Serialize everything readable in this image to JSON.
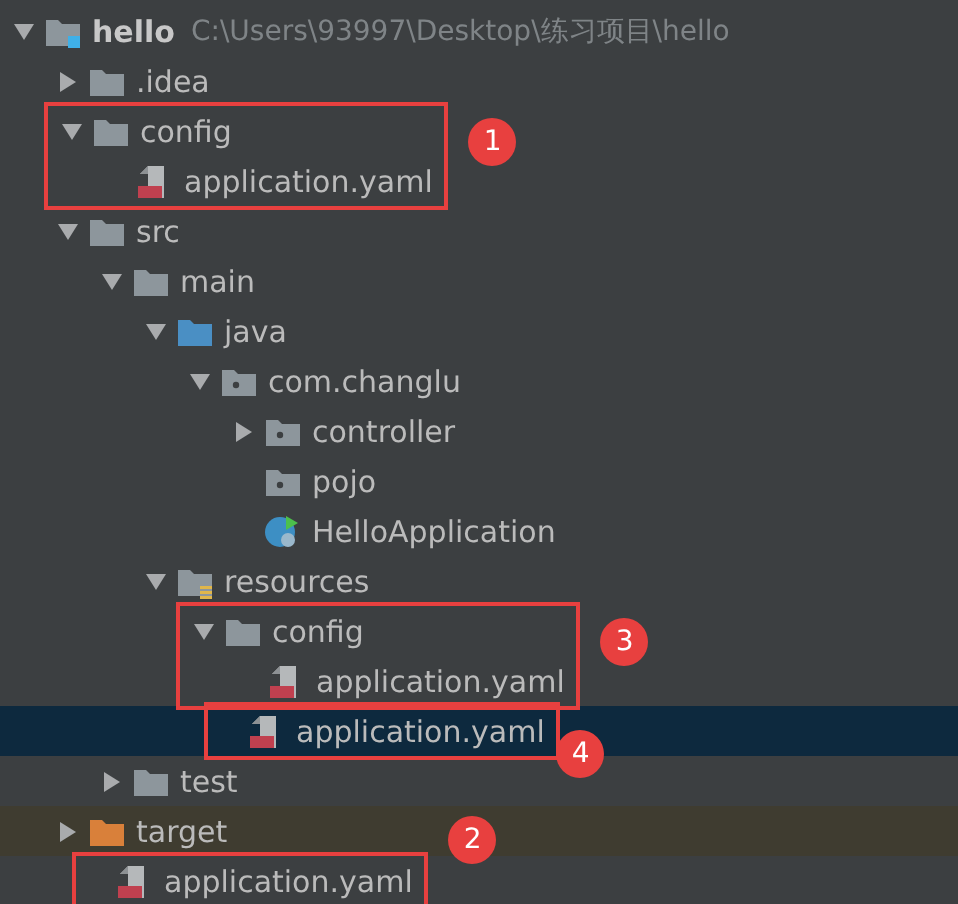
{
  "tree": {
    "label": "hello",
    "kind": "module",
    "path": "C:\\Users\\93997\\Desktop\\练习项目\\hello",
    "expanded": true,
    "selected": false,
    "children": [
      {
        "label": ".idea",
        "kind": "folder",
        "expanded": false,
        "selected": false
      },
      {
        "label": "config",
        "kind": "folder",
        "expanded": true,
        "selected": false,
        "marker": "1",
        "children": [
          {
            "label": "application.yaml",
            "kind": "yaml",
            "selected": false
          }
        ]
      },
      {
        "label": "src",
        "kind": "folder",
        "expanded": true,
        "selected": false,
        "children": [
          {
            "label": "main",
            "kind": "folder",
            "expanded": true,
            "selected": false,
            "children": [
              {
                "label": "java",
                "kind": "source",
                "expanded": true,
                "selected": false,
                "children": [
                  {
                    "label": "com.changlu",
                    "kind": "package",
                    "expanded": true,
                    "selected": false,
                    "children": [
                      {
                        "label": "controller",
                        "kind": "package",
                        "expanded": false,
                        "selected": false
                      },
                      {
                        "label": "pojo",
                        "kind": "package",
                        "selected": false
                      },
                      {
                        "label": "HelloApplication",
                        "kind": "spring-class",
                        "selected": false
                      }
                    ]
                  }
                ]
              },
              {
                "label": "resources",
                "kind": "resources",
                "expanded": true,
                "selected": false,
                "children": [
                  {
                    "label": "config",
                    "kind": "folder",
                    "expanded": true,
                    "selected": false,
                    "marker": "3",
                    "children": [
                      {
                        "label": "application.yaml",
                        "kind": "yaml",
                        "selected": false
                      }
                    ]
                  },
                  {
                    "label": "application.yaml",
                    "kind": "yaml",
                    "selected": true,
                    "marker": "4"
                  }
                ]
              }
            ]
          },
          {
            "label": "test",
            "kind": "folder",
            "expanded": false,
            "selected": false
          }
        ]
      },
      {
        "label": "target",
        "kind": "excluded",
        "expanded": false,
        "selected": false
      },
      {
        "label": "application.yaml",
        "kind": "yaml",
        "selected": false,
        "marker": "2"
      }
    ]
  }
}
